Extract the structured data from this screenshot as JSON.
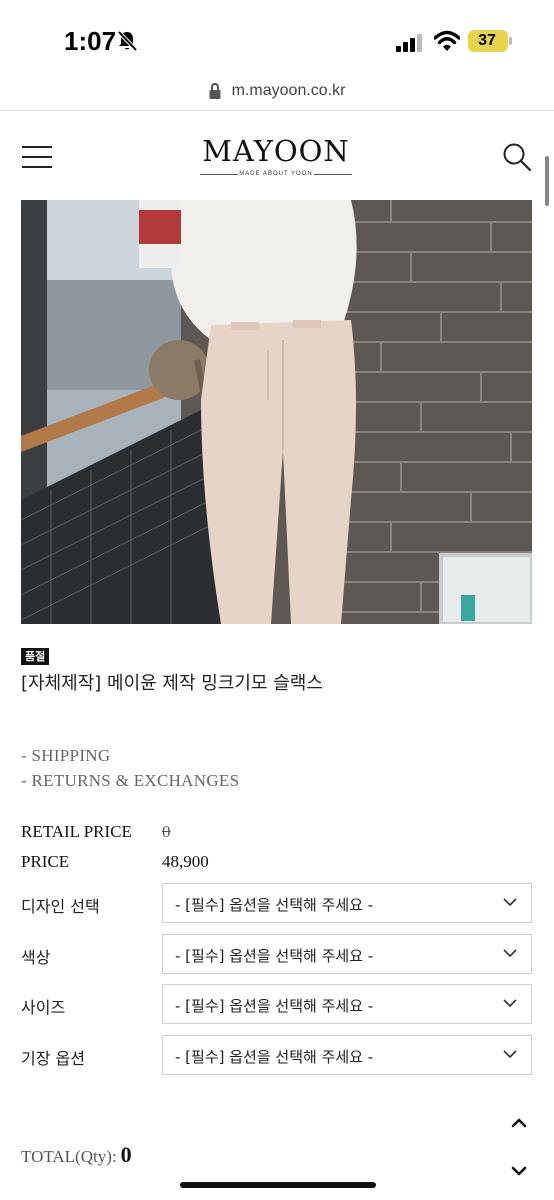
{
  "status_bar": {
    "time": "1:07",
    "battery": "37",
    "icons": [
      "bell-off-icon",
      "cellular-signal-icon",
      "wifi-icon",
      "battery-icon"
    ],
    "battery_color": "#e7d44b"
  },
  "browser": {
    "url": "m.mayoon.co.kr",
    "lock_icon": "lock-icon"
  },
  "header": {
    "logo": "MAYOON",
    "logo_tagline": "MADE ABOUT YOON",
    "menu_icon": "hamburger-menu-icon",
    "search_icon": "search-icon"
  },
  "product": {
    "badge": "품절",
    "name": "[자체제작] 메이윤 제작 밍크기모 슬랙스",
    "links": [
      "- SHIPPING",
      "- RETURNS & EXCHANGES"
    ],
    "retail_price_label": "RETAIL PRICE",
    "retail_price": "0",
    "price_label": "PRICE",
    "price": "48,900"
  },
  "options": [
    {
      "label": "디자인 선택",
      "placeholder": "- [필수] 옵션을 선택해 주세요 -"
    },
    {
      "label": "색상",
      "placeholder": "- [필수] 옵션을 선택해 주세요 -"
    },
    {
      "label": "사이즈",
      "placeholder": "- [필수] 옵션을 선택해 주세요 -"
    },
    {
      "label": "기장 옵션",
      "placeholder": "- [필수] 옵션을 선택해 주세요 -"
    }
  ],
  "total": {
    "label": "TOTAL(Qty):",
    "qty": "0"
  },
  "nav_icons": [
    "chevron-up-icon",
    "chevron-down-icon"
  ]
}
